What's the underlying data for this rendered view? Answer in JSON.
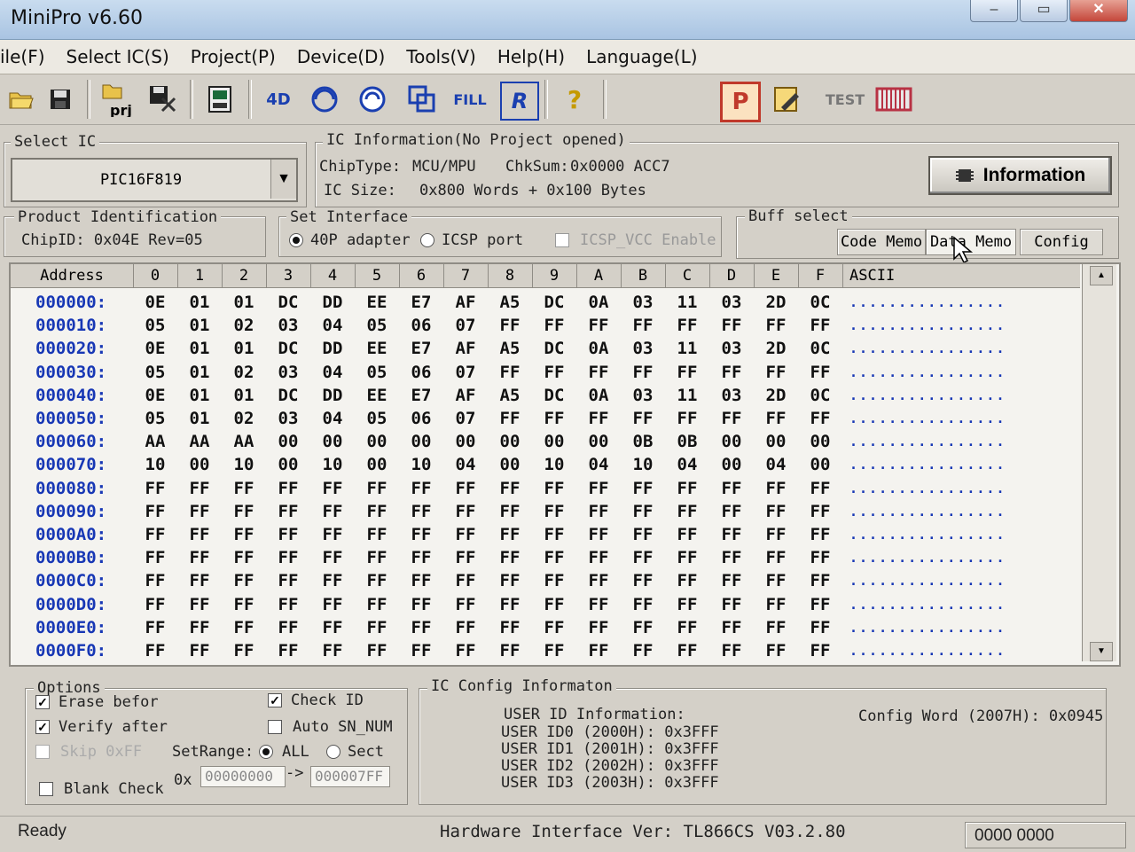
{
  "window": {
    "title": "MiniPro v6.60",
    "btn_min": "‒",
    "btn_max": "▭",
    "btn_close": "✕"
  },
  "menu": [
    "ile(F)",
    "Select IC(S)",
    "Project(P)",
    "Device(D)",
    "Tools(V)",
    "Help(H)",
    "Language(L)"
  ],
  "toolbar": {
    "prj_label": "prj",
    "icon_4d": "4D",
    "icon_fill": "FILL",
    "icon_r": "R",
    "icon_help": "?",
    "icon_p": "P",
    "icon_test": "TEST"
  },
  "select_ic": {
    "legend": "Select IC",
    "value": "PIC16F819"
  },
  "ic_info": {
    "legend": "IC Information(No Project opened)",
    "chip_type_label": "ChipType:",
    "chip_type": "MCU/MPU",
    "chksum_label": "ChkSum:",
    "chksum": "0x0000 ACC7",
    "ic_size_label": "IC Size:",
    "ic_size": "0x800 Words + 0x100 Bytes",
    "info_button": "Information"
  },
  "product_id": {
    "legend": "Product Identification",
    "chip_id": "ChipID: 0x04E Rev=05"
  },
  "interface": {
    "legend": "Set Interface",
    "opt1": "40P adapter",
    "opt2": "ICSP port",
    "vcc": "ICSP_VCC Enable"
  },
  "buff": {
    "legend": "Buff select",
    "tabs": [
      "Code Memo",
      "Data Memo",
      "Config"
    ]
  },
  "grid": {
    "headers": [
      "Address",
      "0",
      "1",
      "2",
      "3",
      "4",
      "5",
      "6",
      "7",
      "8",
      "9",
      "A",
      "B",
      "C",
      "D",
      "E",
      "F",
      "ASCII"
    ],
    "rows": [
      {
        "addr": "000000:",
        "cells": [
          "0E",
          "01",
          "01",
          "DC",
          "DD",
          "EE",
          "E7",
          "AF",
          "A5",
          "DC",
          "0A",
          "03",
          "11",
          "03",
          "2D",
          "0C"
        ],
        "ascii": "................"
      },
      {
        "addr": "000010:",
        "cells": [
          "05",
          "01",
          "02",
          "03",
          "04",
          "05",
          "06",
          "07",
          "FF",
          "FF",
          "FF",
          "FF",
          "FF",
          "FF",
          "FF",
          "FF"
        ],
        "ascii": "................"
      },
      {
        "addr": "000020:",
        "cells": [
          "0E",
          "01",
          "01",
          "DC",
          "DD",
          "EE",
          "E7",
          "AF",
          "A5",
          "DC",
          "0A",
          "03",
          "11",
          "03",
          "2D",
          "0C"
        ],
        "ascii": "................"
      },
      {
        "addr": "000030:",
        "cells": [
          "05",
          "01",
          "02",
          "03",
          "04",
          "05",
          "06",
          "07",
          "FF",
          "FF",
          "FF",
          "FF",
          "FF",
          "FF",
          "FF",
          "FF"
        ],
        "ascii": "................"
      },
      {
        "addr": "000040:",
        "cells": [
          "0E",
          "01",
          "01",
          "DC",
          "DD",
          "EE",
          "E7",
          "AF",
          "A5",
          "DC",
          "0A",
          "03",
          "11",
          "03",
          "2D",
          "0C"
        ],
        "ascii": "................"
      },
      {
        "addr": "000050:",
        "cells": [
          "05",
          "01",
          "02",
          "03",
          "04",
          "05",
          "06",
          "07",
          "FF",
          "FF",
          "FF",
          "FF",
          "FF",
          "FF",
          "FF",
          "FF"
        ],
        "ascii": "................"
      },
      {
        "addr": "000060:",
        "cells": [
          "AA",
          "AA",
          "AA",
          "00",
          "00",
          "00",
          "00",
          "00",
          "00",
          "00",
          "00",
          "0B",
          "0B",
          "00",
          "00",
          "00"
        ],
        "ascii": "................"
      },
      {
        "addr": "000070:",
        "cells": [
          "10",
          "00",
          "10",
          "00",
          "10",
          "00",
          "10",
          "04",
          "00",
          "10",
          "04",
          "10",
          "04",
          "00",
          "04",
          "00"
        ],
        "ascii": "................"
      },
      {
        "addr": "000080:",
        "cells": [
          "FF",
          "FF",
          "FF",
          "FF",
          "FF",
          "FF",
          "FF",
          "FF",
          "FF",
          "FF",
          "FF",
          "FF",
          "FF",
          "FF",
          "FF",
          "FF"
        ],
        "ascii": "................"
      },
      {
        "addr": "000090:",
        "cells": [
          "FF",
          "FF",
          "FF",
          "FF",
          "FF",
          "FF",
          "FF",
          "FF",
          "FF",
          "FF",
          "FF",
          "FF",
          "FF",
          "FF",
          "FF",
          "FF"
        ],
        "ascii": "................"
      },
      {
        "addr": "0000A0:",
        "cells": [
          "FF",
          "FF",
          "FF",
          "FF",
          "FF",
          "FF",
          "FF",
          "FF",
          "FF",
          "FF",
          "FF",
          "FF",
          "FF",
          "FF",
          "FF",
          "FF"
        ],
        "ascii": "................"
      },
      {
        "addr": "0000B0:",
        "cells": [
          "FF",
          "FF",
          "FF",
          "FF",
          "FF",
          "FF",
          "FF",
          "FF",
          "FF",
          "FF",
          "FF",
          "FF",
          "FF",
          "FF",
          "FF",
          "FF"
        ],
        "ascii": "................"
      },
      {
        "addr": "0000C0:",
        "cells": [
          "FF",
          "FF",
          "FF",
          "FF",
          "FF",
          "FF",
          "FF",
          "FF",
          "FF",
          "FF",
          "FF",
          "FF",
          "FF",
          "FF",
          "FF",
          "FF"
        ],
        "ascii": "................"
      },
      {
        "addr": "0000D0:",
        "cells": [
          "FF",
          "FF",
          "FF",
          "FF",
          "FF",
          "FF",
          "FF",
          "FF",
          "FF",
          "FF",
          "FF",
          "FF",
          "FF",
          "FF",
          "FF",
          "FF"
        ],
        "ascii": "................"
      },
      {
        "addr": "0000E0:",
        "cells": [
          "FF",
          "FF",
          "FF",
          "FF",
          "FF",
          "FF",
          "FF",
          "FF",
          "FF",
          "FF",
          "FF",
          "FF",
          "FF",
          "FF",
          "FF",
          "FF"
        ],
        "ascii": "................"
      },
      {
        "addr": "0000F0:",
        "cells": [
          "FF",
          "FF",
          "FF",
          "FF",
          "FF",
          "FF",
          "FF",
          "FF",
          "FF",
          "FF",
          "FF",
          "FF",
          "FF",
          "FF",
          "FF",
          "FF"
        ],
        "ascii": "................"
      }
    ]
  },
  "options": {
    "legend": "Options",
    "erase": "Erase befor",
    "verify": "Verify after",
    "skip": "Skip 0xFF",
    "blank": "Blank Check",
    "check_id": "Check ID",
    "auto_sn": "Auto SN_NUM",
    "setrange": "SetRange:",
    "all": "ALL",
    "sect": "Sect",
    "ox": "0x",
    "arrow": "->",
    "from": "00000000",
    "to": "000007FF"
  },
  "config": {
    "legend": "IC Config Informaton",
    "user_id_title": "USER ID Information:",
    "ids": [
      "USER ID0  (2000H): 0x3FFF",
      "USER ID1  (2001H): 0x3FFF",
      "USER ID2  (2002H): 0x3FFF",
      "USER ID3  (2003H): 0x3FFF"
    ],
    "config_word": "Config Word  (2007H): 0x0945"
  },
  "status": {
    "left": "Ready",
    "hw": "Hardware Interface Ver: TL866CS V03.2.80",
    "right": "0000 0000"
  },
  "colors": {
    "address_blue": "#1737b5",
    "window_bg": "#d4d0c8"
  }
}
